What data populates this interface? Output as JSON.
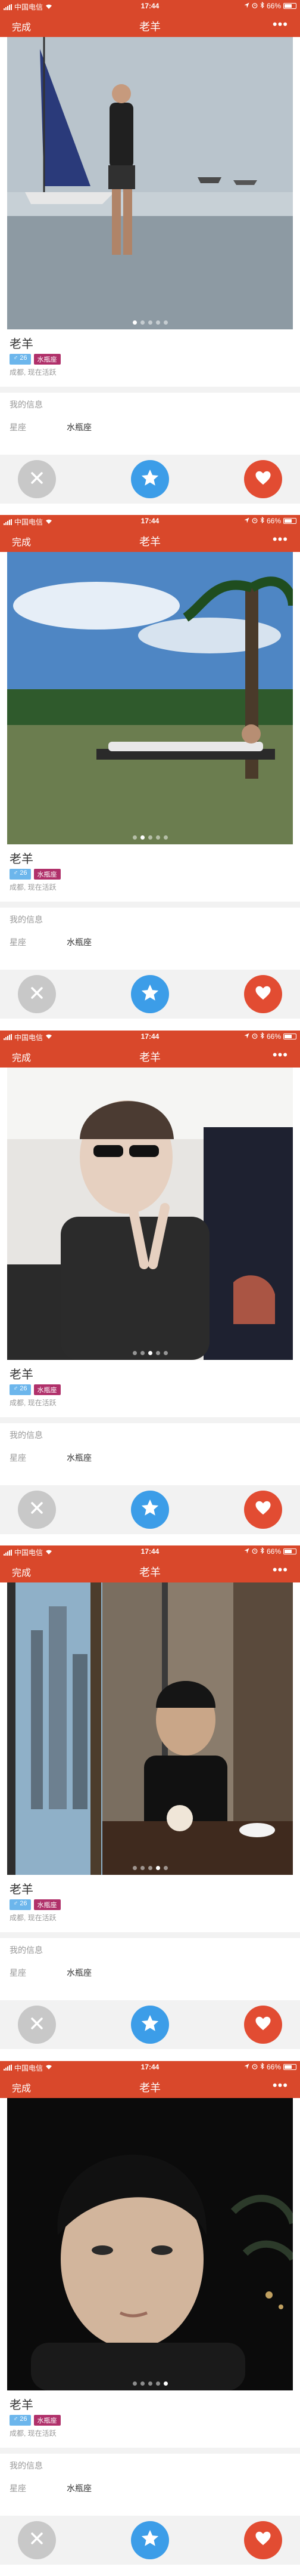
{
  "status_bar": {
    "carrier": "中国电信",
    "time": "17:44",
    "battery_percent": "66%"
  },
  "nav": {
    "done_label": "完成",
    "title": "老羊",
    "more_label": "•••"
  },
  "colors": {
    "header": "#d9482b",
    "age_badge": "#6cb6ec",
    "zodiac_badge": "#b0306a",
    "pass_button": "#c8c8c8",
    "star_button": "#3c9de8",
    "like_button": "#e24c32"
  },
  "icons": {
    "wifi": "wifi-icon",
    "location": "location-arrow-icon",
    "alarm": "alarm-icon",
    "bluetooth": "bluetooth-icon",
    "battery": "battery-icon",
    "pass": "close-icon",
    "star": "star-icon",
    "like": "heart-icon"
  },
  "profile": {
    "name": "老羊",
    "age_badge": "♂ 26",
    "zodiac_badge": "水瓶座",
    "location": "成都, 现在活跃",
    "section_title": "我的信息",
    "zodiac_label": "星座",
    "zodiac_value": "水瓶座"
  },
  "cards": [
    {
      "photo": "sailboat-beach",
      "photo_count": 5,
      "active_photo": 1
    },
    {
      "photo": "poolside-lounger",
      "photo_count": 5,
      "active_photo": 2
    },
    {
      "photo": "car-selfie",
      "photo_count": 5,
      "active_photo": 3
    },
    {
      "photo": "window-cafe",
      "photo_count": 5,
      "active_photo": 4
    },
    {
      "photo": "night-selfie",
      "photo_count": 5,
      "active_photo": 5
    }
  ]
}
